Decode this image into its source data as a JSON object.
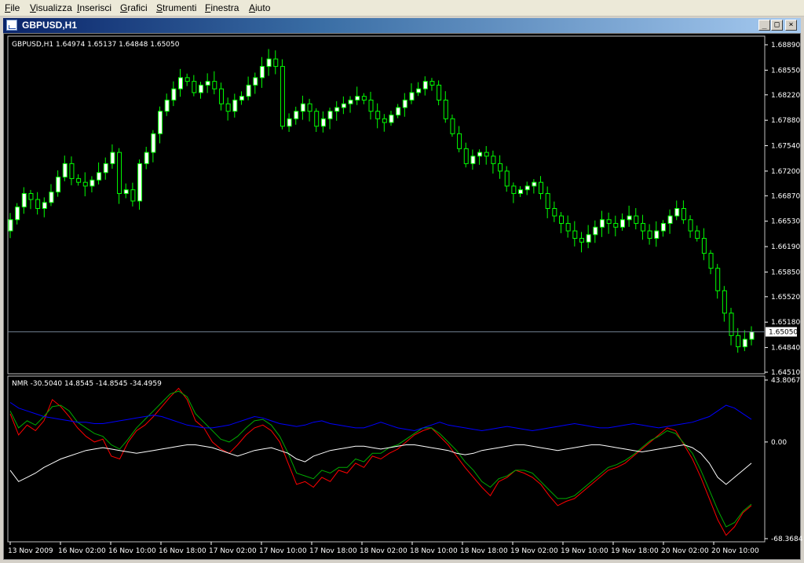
{
  "menu": [
    {
      "label": "File",
      "u": "F",
      "rest": "ile",
      "x": 6
    },
    {
      "label": "Visualizza",
      "u": "V",
      "rest": "isualizza",
      "x": 38
    },
    {
      "label": "Inserisci",
      "u": "I",
      "rest": "nserisci",
      "x": 98
    },
    {
      "label": "Grafici",
      "u": "G",
      "rest": "rafici",
      "x": 153
    },
    {
      "label": "Strumenti",
      "u": "S",
      "rest": "trumenti",
      "x": 199
    },
    {
      "label": "Finestra",
      "u": "F",
      "rest": "inestra",
      "x": 261
    },
    {
      "label": "Aiuto",
      "u": "A",
      "rest": "iuto",
      "x": 317
    }
  ],
  "window": {
    "title": "GBPUSD,H1",
    "min": "_",
    "max": "□",
    "close": "×"
  },
  "price_panel": {
    "header": "GBPUSD,H1  1.64974  1.65137  1.64848  1.65050",
    "y_labels": [
      "1.68890",
      "1.68550",
      "1.68220",
      "1.67880",
      "1.67540",
      "1.67200",
      "1.66870",
      "1.66530",
      "1.66190",
      "1.65850",
      "1.65520",
      "1.65180",
      "1.64840",
      "1.64510"
    ],
    "current_price": "1.65050"
  },
  "indicator_panel": {
    "header": "NMR -30.5040 14.8545 -14.8545 -34.4959",
    "y_labels": [
      "43.8067",
      "0.00",
      "-68.3684"
    ]
  },
  "x_labels": [
    "13 Nov 2009",
    "16 Nov 02:00",
    "16 Nov 10:00",
    "16 Nov 18:00",
    "17 Nov 02:00",
    "17 Nov 10:00",
    "17 Nov 18:00",
    "18 Nov 02:00",
    "18 Nov 10:00",
    "18 Nov 18:00",
    "19 Nov 02:00",
    "19 Nov 10:00",
    "19 Nov 18:00",
    "20 Nov 02:00",
    "20 Nov 10:00"
  ],
  "colors": {
    "bull": "#ffffff",
    "wick": "#00ff00",
    "red": "#ff0000",
    "green": "#00aa00",
    "blue": "#0000ff",
    "white": "#ffffff",
    "axis": "#ffffff"
  },
  "chart_data": [
    {
      "type": "candlestick",
      "title": "GBPUSD,H1",
      "ylim": [
        1.6451,
        1.6889
      ],
      "close": [
        1.6655,
        1.6672,
        1.669,
        1.6682,
        1.667,
        1.6678,
        1.6692,
        1.6712,
        1.673,
        1.671,
        1.6705,
        1.67,
        1.6708,
        1.6718,
        1.673,
        1.6745,
        1.669,
        1.6695,
        1.668,
        1.673,
        1.6745,
        1.677,
        1.68,
        1.6815,
        1.683,
        1.6845,
        1.684,
        1.6825,
        1.6835,
        1.684,
        1.683,
        1.681,
        1.68,
        1.6815,
        1.682,
        1.6835,
        1.6845,
        1.686,
        1.687,
        1.686,
        1.678,
        1.679,
        1.68,
        1.681,
        1.68,
        1.678,
        1.679,
        1.68,
        1.6805,
        1.681,
        1.6815,
        1.682,
        1.6815,
        1.68,
        1.679,
        1.6785,
        1.6795,
        1.6805,
        1.6815,
        1.6825,
        1.683,
        1.684,
        1.6835,
        1.6815,
        1.679,
        1.677,
        1.675,
        1.673,
        1.674,
        1.6745,
        1.674,
        1.673,
        1.672,
        1.67,
        1.669,
        1.6695,
        1.67,
        1.6705,
        1.669,
        1.667,
        1.666,
        1.665,
        1.664,
        1.663,
        1.6625,
        1.6635,
        1.6645,
        1.6655,
        1.665,
        1.6645,
        1.6655,
        1.666,
        1.665,
        1.664,
        1.663,
        1.664,
        1.665,
        1.666,
        1.667,
        1.6655,
        1.664,
        1.663,
        1.661,
        1.659,
        1.656,
        1.653,
        1.65,
        1.6485,
        1.6495,
        1.6505
      ]
    },
    {
      "type": "line",
      "title": "NMR",
      "ylim": [
        -68.3684,
        43.8067
      ],
      "series": [
        {
          "color": "red",
          "values": [
            20,
            5,
            12,
            8,
            15,
            30,
            25,
            18,
            10,
            4,
            0,
            2,
            -10,
            -12,
            0,
            8,
            12,
            18,
            25,
            32,
            38,
            30,
            15,
            10,
            0,
            -5,
            -8,
            -2,
            5,
            10,
            12,
            8,
            0,
            -15,
            -30,
            -28,
            -32,
            -25,
            -28,
            -20,
            -22,
            -15,
            -18,
            -10,
            -12,
            -8,
            -5,
            0,
            5,
            8,
            10,
            4,
            -2,
            -10,
            -18,
            -25,
            -32,
            -38,
            -28,
            -25,
            -20,
            -22,
            -25,
            -30,
            -38,
            -45,
            -42,
            -40,
            -35,
            -30,
            -25,
            -20,
            -18,
            -15,
            -10,
            -5,
            0,
            5,
            10,
            8,
            -2,
            -12,
            -25,
            -40,
            -55,
            -66,
            -60,
            -50,
            -45
          ]
        },
        {
          "color": "green",
          "values": [
            22,
            10,
            15,
            12,
            18,
            25,
            26,
            22,
            14,
            10,
            6,
            4,
            -2,
            -5,
            2,
            10,
            16,
            22,
            28,
            34,
            36,
            32,
            20,
            14,
            8,
            2,
            0,
            4,
            10,
            15,
            16,
            12,
            4,
            -8,
            -22,
            -24,
            -26,
            -20,
            -22,
            -18,
            -18,
            -12,
            -14,
            -8,
            -8,
            -4,
            -2,
            2,
            6,
            10,
            10,
            6,
            0,
            -6,
            -14,
            -20,
            -28,
            -32,
            -26,
            -24,
            -20,
            -20,
            -22,
            -28,
            -34,
            -40,
            -40,
            -38,
            -33,
            -28,
            -23,
            -18,
            -16,
            -13,
            -9,
            -4,
            1,
            4,
            8,
            6,
            -1,
            -8,
            -20,
            -34,
            -48,
            -60,
            -57,
            -49,
            -44
          ]
        },
        {
          "color": "blue",
          "values": [
            28,
            24,
            22,
            20,
            18,
            17,
            16,
            15,
            14,
            14,
            13,
            13,
            14,
            15,
            16,
            17,
            18,
            19,
            18,
            16,
            14,
            12,
            11,
            10,
            10,
            11,
            12,
            14,
            16,
            18,
            17,
            15,
            13,
            12,
            11,
            12,
            14,
            15,
            13,
            12,
            11,
            10,
            10,
            12,
            14,
            12,
            10,
            9,
            8,
            10,
            12,
            14,
            12,
            11,
            10,
            9,
            8,
            9,
            10,
            11,
            10,
            9,
            8,
            9,
            10,
            11,
            12,
            13,
            12,
            11,
            10,
            10,
            11,
            12,
            13,
            12,
            11,
            10,
            11,
            12,
            13,
            14,
            16,
            18,
            22,
            26,
            24,
            20,
            16
          ]
        },
        {
          "color": "white",
          "values": [
            -20,
            -28,
            -25,
            -22,
            -18,
            -15,
            -12,
            -10,
            -8,
            -6,
            -5,
            -4,
            -5,
            -6,
            -7,
            -8,
            -7,
            -6,
            -5,
            -4,
            -3,
            -2,
            -2,
            -3,
            -4,
            -6,
            -8,
            -10,
            -8,
            -6,
            -5,
            -4,
            -6,
            -8,
            -12,
            -14,
            -10,
            -8,
            -6,
            -5,
            -4,
            -3,
            -3,
            -4,
            -5,
            -4,
            -3,
            -2,
            -2,
            -3,
            -4,
            -5,
            -6,
            -8,
            -9,
            -8,
            -6,
            -5,
            -4,
            -3,
            -2,
            -2,
            -3,
            -4,
            -5,
            -6,
            -5,
            -4,
            -3,
            -2,
            -2,
            -3,
            -4,
            -5,
            -6,
            -7,
            -6,
            -5,
            -4,
            -3,
            -2,
            -4,
            -8,
            -15,
            -25,
            -30,
            -25,
            -20,
            -15
          ]
        }
      ]
    }
  ]
}
